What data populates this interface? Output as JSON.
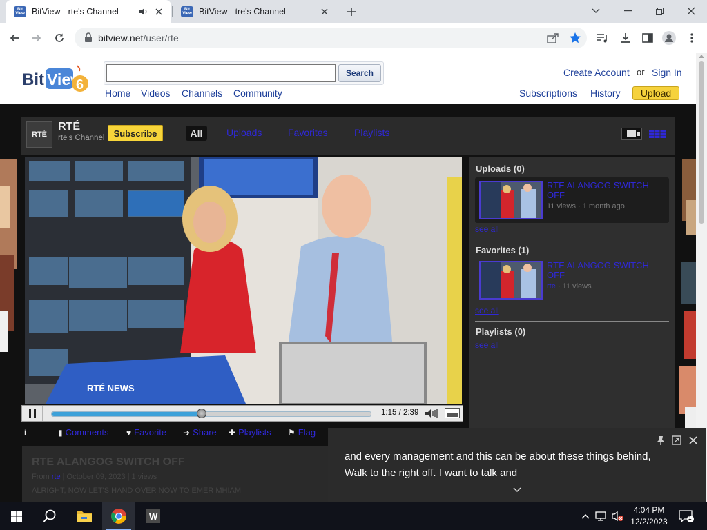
{
  "browser": {
    "tabs": [
      {
        "title": "BitView - rte's Channel",
        "active": true,
        "audio": true,
        "favicon": "Bit View"
      },
      {
        "title": "BitView - tre's Channel",
        "active": false,
        "audio": false,
        "favicon": "Bit View"
      }
    ],
    "url_host": "bitview.net",
    "url_path": "/user/rte"
  },
  "header": {
    "logo_text": "BitView",
    "logo_badge": "6",
    "search_value": "",
    "search_button": "Search",
    "nav": [
      "Home",
      "Videos",
      "Channels",
      "Community"
    ],
    "create_account": "Create Account",
    "or": "or",
    "sign_in": "Sign In",
    "subscriptions": "Subscriptions",
    "history": "History",
    "upload": "Upload"
  },
  "channel": {
    "avatar_text": "RTÉ",
    "name": "RTÉ",
    "subtitle": "rte's Channel",
    "subscribe": "Subscribe",
    "tabs": [
      "All",
      "Uploads",
      "Favorites",
      "Playlists"
    ]
  },
  "player": {
    "time": "1:15 / 2:39",
    "progress": 0.47,
    "video_overlay": "RTÉ NEWS"
  },
  "actions": [
    "Comments",
    "Favorite",
    "Share",
    "Playlists",
    "Flag"
  ],
  "video_info": {
    "title": "RTE ALANGOG SWITCH OFF",
    "from_label": "From",
    "from_user": "rte",
    "from_rest": "| October 09, 2023 | 1 views",
    "description": "ALRIGHT, NOW LET'S HAND OVER NOW TO EMER MHIAM"
  },
  "sidebar": {
    "uploads_heading": "Uploads (0)",
    "uploads_item": {
      "title": "RTE ALANGOG SWITCH OFF",
      "meta": "11 views · 1 month ago"
    },
    "favorites_heading": "Favorites (1)",
    "favorites_item": {
      "title": "RTE ALANGOG SWITCH OFF",
      "by": "rte",
      "meta": "· 11 views"
    },
    "playlists_heading": "Playlists (0)",
    "see_all": "see all"
  },
  "live_caption": {
    "line1": "and every management and this can be about these things behind,",
    "line2": "Walk to the right off. I want to talk and"
  },
  "taskbar": {
    "time": "4:04 PM",
    "date": "12/2/2023",
    "notification_count": "1"
  },
  "colors": {
    "link": "#1d3f9a",
    "channel_link": "#2f28d6",
    "subscribe_yellow": "#f7d53a",
    "channel_bg": "#111111"
  }
}
